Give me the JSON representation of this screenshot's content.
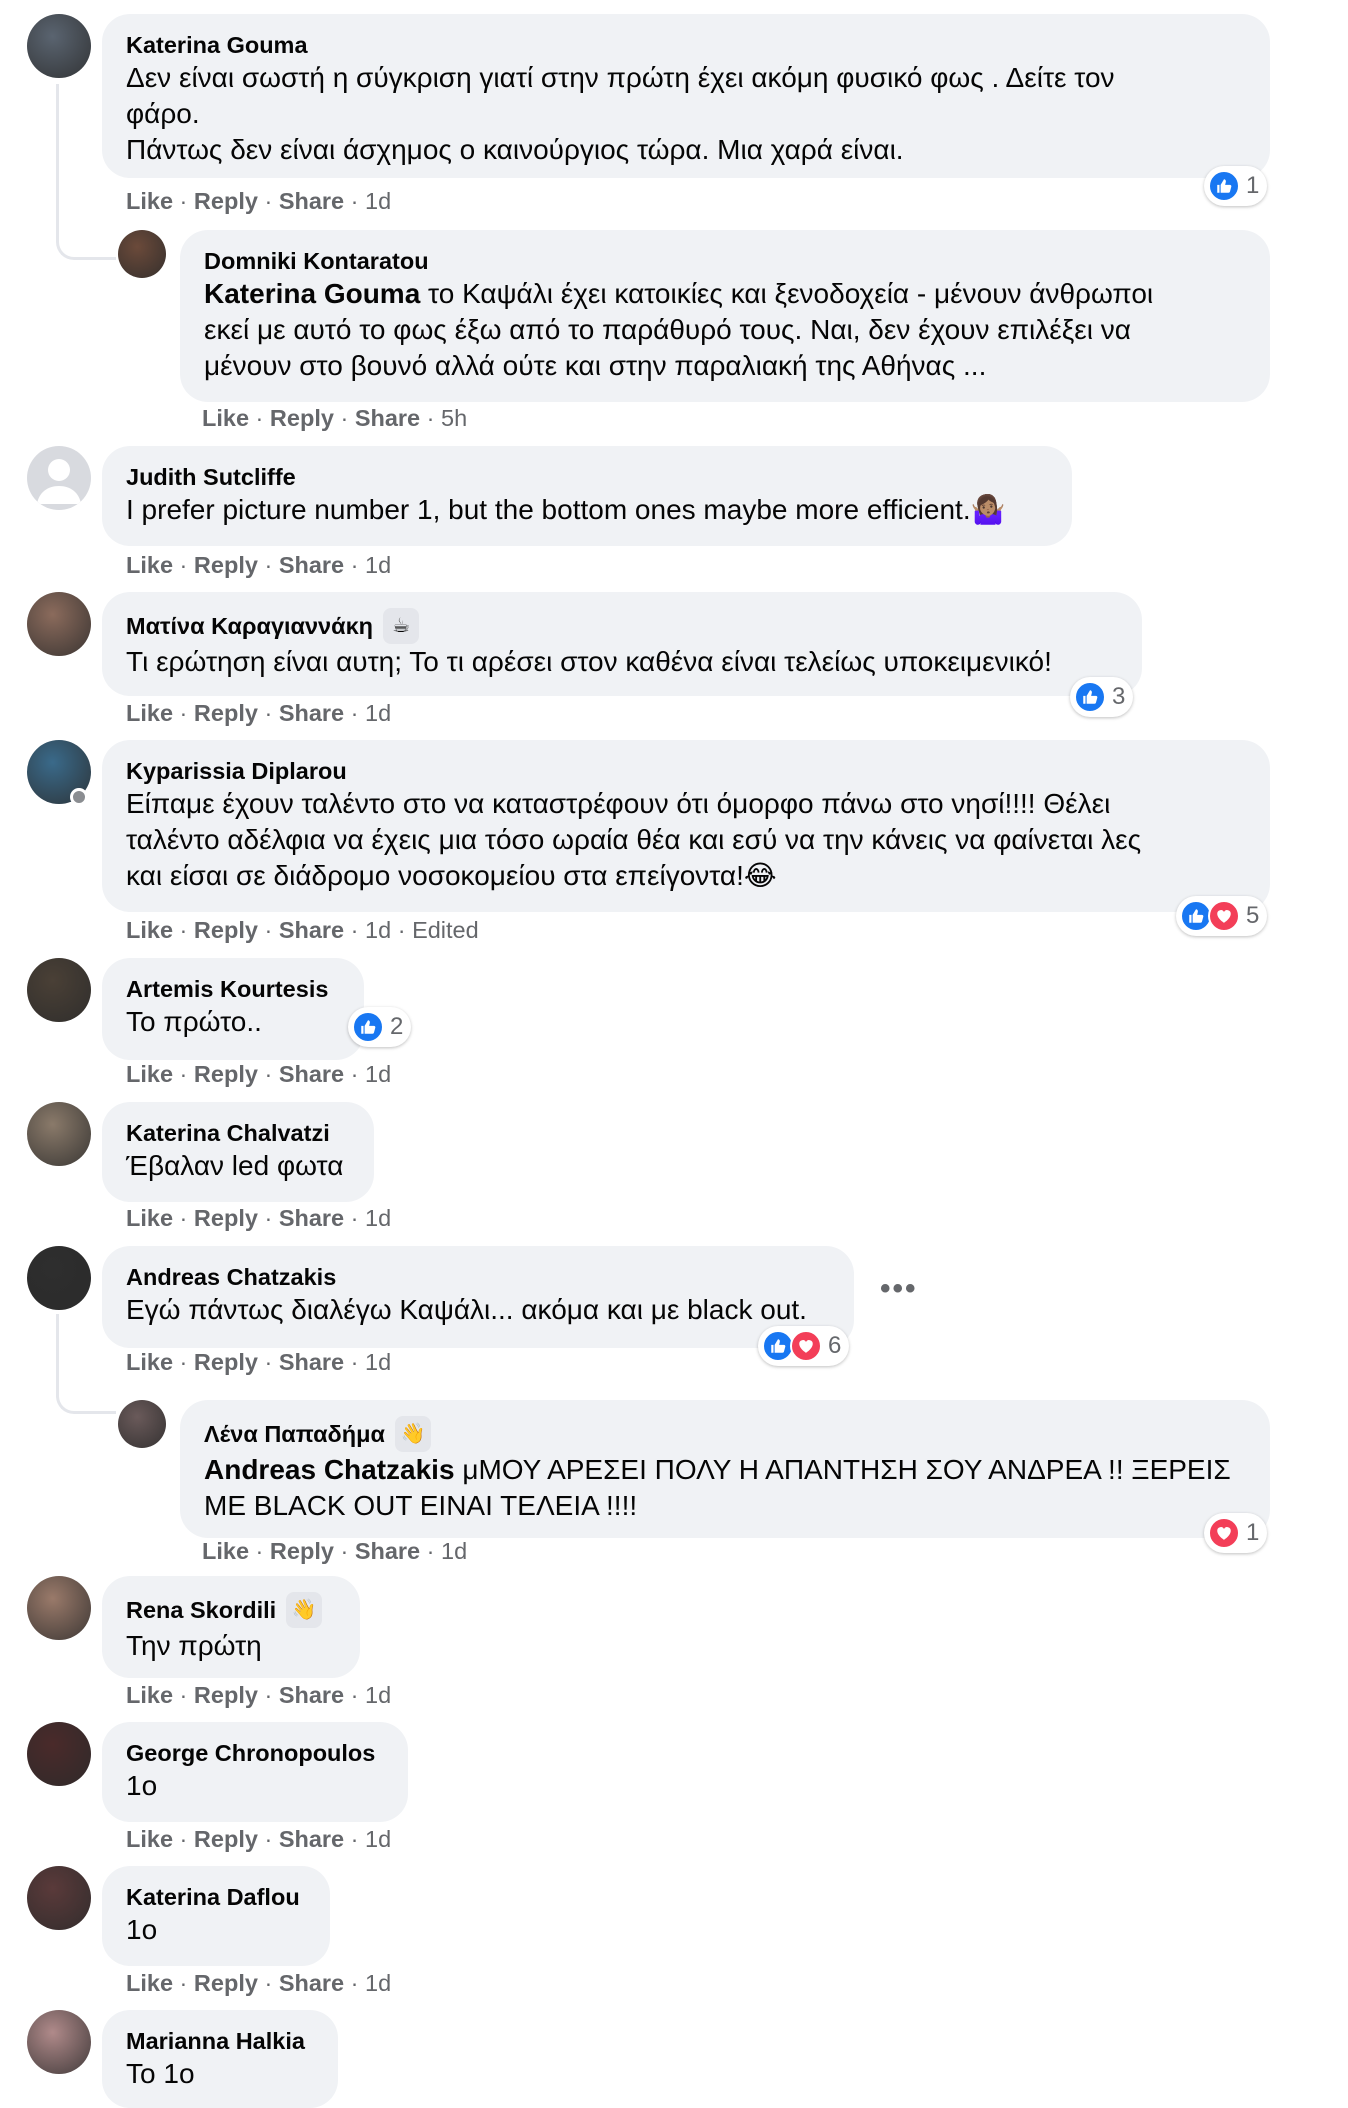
{
  "actions": {
    "like": "Like",
    "reply": "Reply",
    "share": "Share",
    "sep": " · "
  },
  "colors": {
    "like": "#1877f2",
    "love": "#f33e58",
    "bubble": "#f0f2f5",
    "meta": "#65676b"
  },
  "comments": [
    {
      "author": "Katerina Gouma",
      "lines": [
        "Δεν είναι σωστή η σύγκριση γιατί στην πρώτη έχει ακόμη φυσικό φως . Δείτε τον",
        "φάρο.",
        "Πάντως δεν είναι άσχημος ο καινούργιος τώρα. Μια χαρά είναι."
      ],
      "time": "1d",
      "reactions": "1",
      "reaction_types": [
        "like"
      ]
    },
    {
      "author": "Domniki Kontaratou",
      "mention": "Katerina Gouma",
      "lines": [
        " το Καψάλι έχει κατοικίες και ξενοδοχεία - μένουν άνθρωποι",
        "εκεί με αυτό το φως έξω από το παράθυρό τους. Ναι, δεν έχουν επιλέξει να",
        "μένουν στο βουνό αλλά ούτε και στην παραλιακή της Αθήνας ..."
      ],
      "time": "5h"
    },
    {
      "author": "Judith Sutcliffe",
      "lines": [
        "I prefer picture number 1, but the bottom ones maybe more efficient.🤷🏽‍♀️"
      ],
      "time": "1d"
    },
    {
      "author": "Ματίνα Καραγιαννάκη",
      "badge": "☕",
      "lines": [
        "Τι ερώτηση είναι αυτη; Το τι αρέσει στον καθένα είναι τελείως υποκειμενικό!"
      ],
      "time": "1d",
      "reactions": "3",
      "reaction_types": [
        "like"
      ]
    },
    {
      "author": "Kyparissia Diplarou",
      "lines": [
        "Είπαμε έχουν ταλέντο στο να καταστρέφουν ότι όμορφο πάνω στο νησί!!!! Θέλει",
        "ταλέντο αδέλφια να έχεις μια τόσο ωραία θέα και εσύ να την κάνεις να φαίνεται λες",
        "και είσαι σε διάδρομο νοσοκομείου στα επείγοντα!😂"
      ],
      "time": "1d",
      "edited": "Edited",
      "reactions": "5",
      "reaction_types": [
        "like",
        "love"
      ]
    },
    {
      "author": "Artemis Kourtesis",
      "lines": [
        "Το πρώτο.."
      ],
      "time": "1d",
      "reactions": "2",
      "reaction_types": [
        "like"
      ]
    },
    {
      "author": "Katerina Chalvatzi",
      "lines": [
        "Έβαλαν led φωτα"
      ],
      "time": "1d"
    },
    {
      "author": "Andreas Chatzakis",
      "lines": [
        "Εγώ πάντως διαλέγω Καψάλι... ακόμα και με black out."
      ],
      "time": "1d",
      "reactions": "6",
      "reaction_types": [
        "like",
        "love"
      ],
      "more": "•••"
    },
    {
      "author": "Λένα Παπαδήμα",
      "badge": "👋",
      "mention": "Andreas Chatzakis",
      "lines": [
        " μΜΟΥ ΑΡΕΣΕΙ ΠΟΛΥ Η ΑΠΑΝΤΗΣΗ ΣΟΥ ΑΝΔΡΕΑ !! ΞΕΡΕΙΣ",
        "ΜΕ BLACK OUT ΕΙΝΑΙ ΤΕΛΕΙΑ !!!!"
      ],
      "time": "1d",
      "reactions": "1",
      "reaction_types": [
        "love"
      ]
    },
    {
      "author": "Rena Skordili",
      "badge": "👋",
      "lines": [
        "Την πρώτη"
      ],
      "time": "1d"
    },
    {
      "author": "George Chronopoulos",
      "lines": [
        "1ο"
      ],
      "time": "1d"
    },
    {
      "author": "Katerina Daflou",
      "lines": [
        "1ο"
      ],
      "time": "1d"
    },
    {
      "author": "Marianna Halkia",
      "lines": [
        "Το 1ο"
      ]
    }
  ]
}
